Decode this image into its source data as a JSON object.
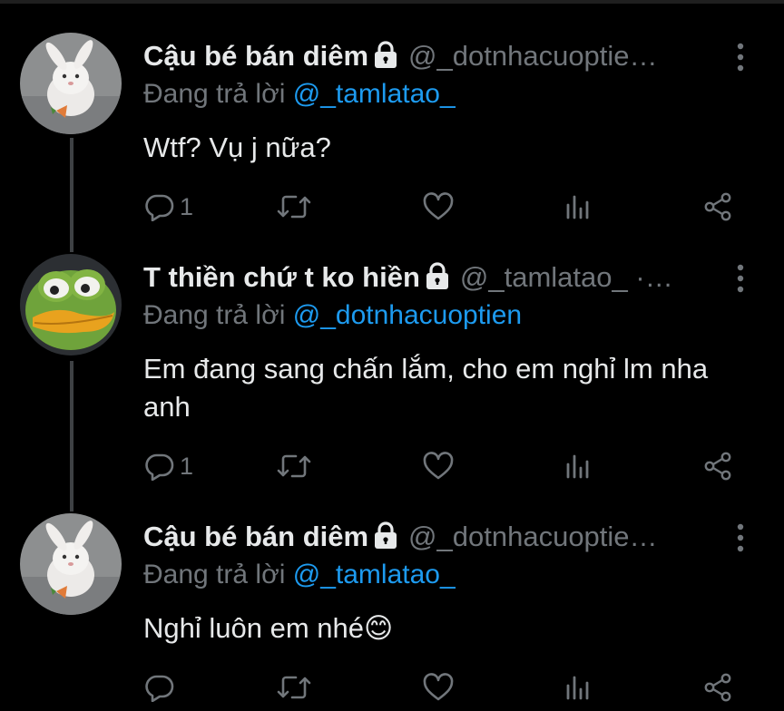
{
  "colors": {
    "background": "#000000",
    "text": "#e7e9ea",
    "secondary": "#71767b",
    "mention": "#1d9bf0",
    "thread_line": "#3e4144"
  },
  "replying_label": "Đang trả lời",
  "tweets": [
    {
      "author_name": "Cậu bé bán diêm",
      "handle": "@_dotnhacuoptie…",
      "protected_icon": "lock-icon",
      "reply_to": "@_tamlatao_",
      "text": "Wtf? Vụ j nữa?",
      "reply_count": "1",
      "avatar": "white-rabbit-avatar"
    },
    {
      "author_name": "T thiền chứ t ko hiền",
      "handle": "@_tamlatao_ ·…",
      "protected_icon": "lock-icon",
      "reply_to": "@_dotnhacuoptien",
      "text": "Em đang sang chấn lắm, cho em nghỉ lm nha anh",
      "reply_count": "1",
      "avatar": "green-frog-avatar"
    },
    {
      "author_name": "Cậu bé bán diêm",
      "handle": "@_dotnhacuoptie…",
      "protected_icon": "lock-icon",
      "reply_to": "@_tamlatao_",
      "text": "Nghỉ luôn em nhé😊",
      "reply_count": "",
      "avatar": "white-rabbit-avatar"
    }
  ],
  "action_icons": [
    "reply-icon",
    "retweet-icon",
    "like-icon",
    "views-icon",
    "share-icon"
  ]
}
